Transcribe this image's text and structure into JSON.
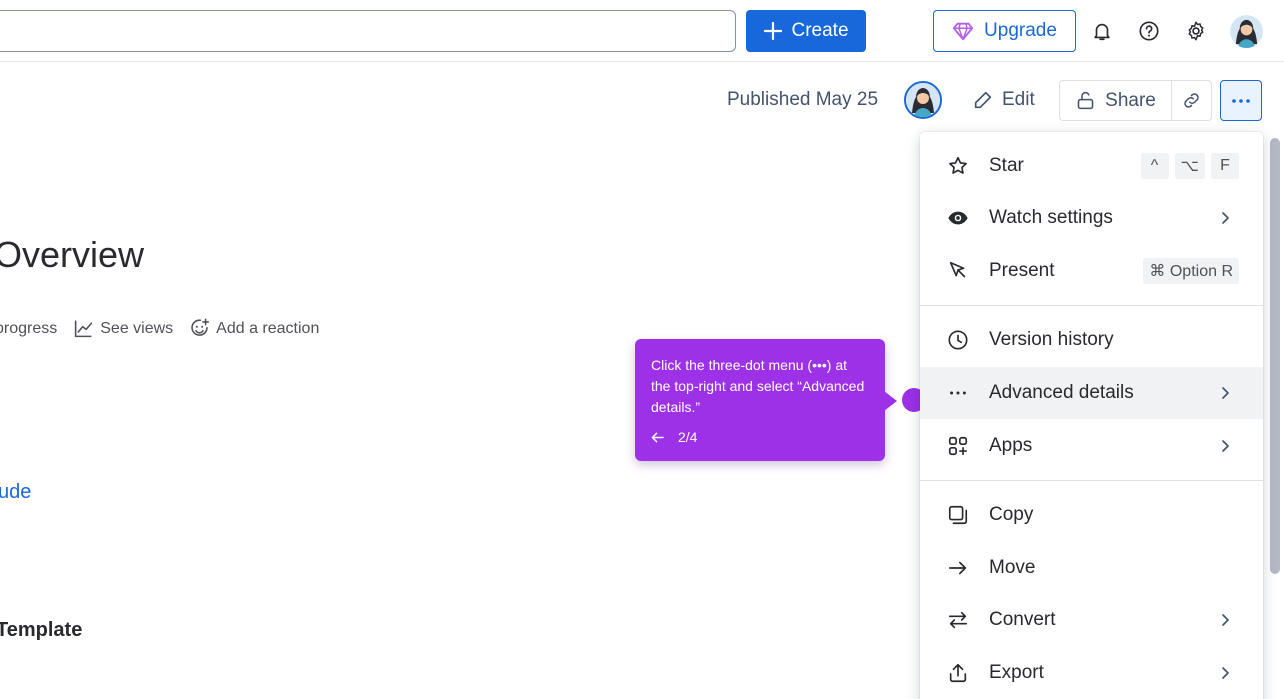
{
  "header": {
    "search_placeholder": "",
    "create_label": "Create",
    "upgrade_label": "Upgrade"
  },
  "page_header": {
    "published_label": "Published May 25",
    "edit_label": "Edit",
    "share_label": "Share"
  },
  "page": {
    "title": "Overview",
    "meta": {
      "progress_label": "progress",
      "views_label": "See views",
      "reaction_label": "Add a reaction"
    },
    "link_text": "ude",
    "section_heading": "Template"
  },
  "tooltip": {
    "text": "Click the three-dot menu (•••) at the top-right and select “Advanced details.”",
    "step": "2/4"
  },
  "menu": {
    "items": [
      {
        "label": "Star",
        "icon": "star-icon",
        "shortcut": [
          "^",
          "⌥",
          "F"
        ]
      },
      {
        "label": "Watch settings",
        "icon": "eye-icon"
      },
      {
        "label": "Present",
        "icon": "present-pointer-icon",
        "shortcut": [
          "⌘ Option R"
        ]
      },
      {
        "label": "Version history",
        "icon": "clock-icon"
      },
      {
        "label": "Advanced details",
        "icon": "more-dots-icon"
      },
      {
        "label": "Apps",
        "icon": "apps-icon"
      },
      {
        "label": "Copy",
        "icon": "copy-icon"
      },
      {
        "label": "Move",
        "icon": "arrow-right-icon"
      },
      {
        "label": "Convert",
        "icon": "convert-icon"
      },
      {
        "label": "Export",
        "icon": "export-icon"
      }
    ]
  },
  "colors": {
    "brand_blue": "#1868db",
    "tooltip_purple": "#9c31e8",
    "upgrade_gem": "#b55fe8"
  }
}
